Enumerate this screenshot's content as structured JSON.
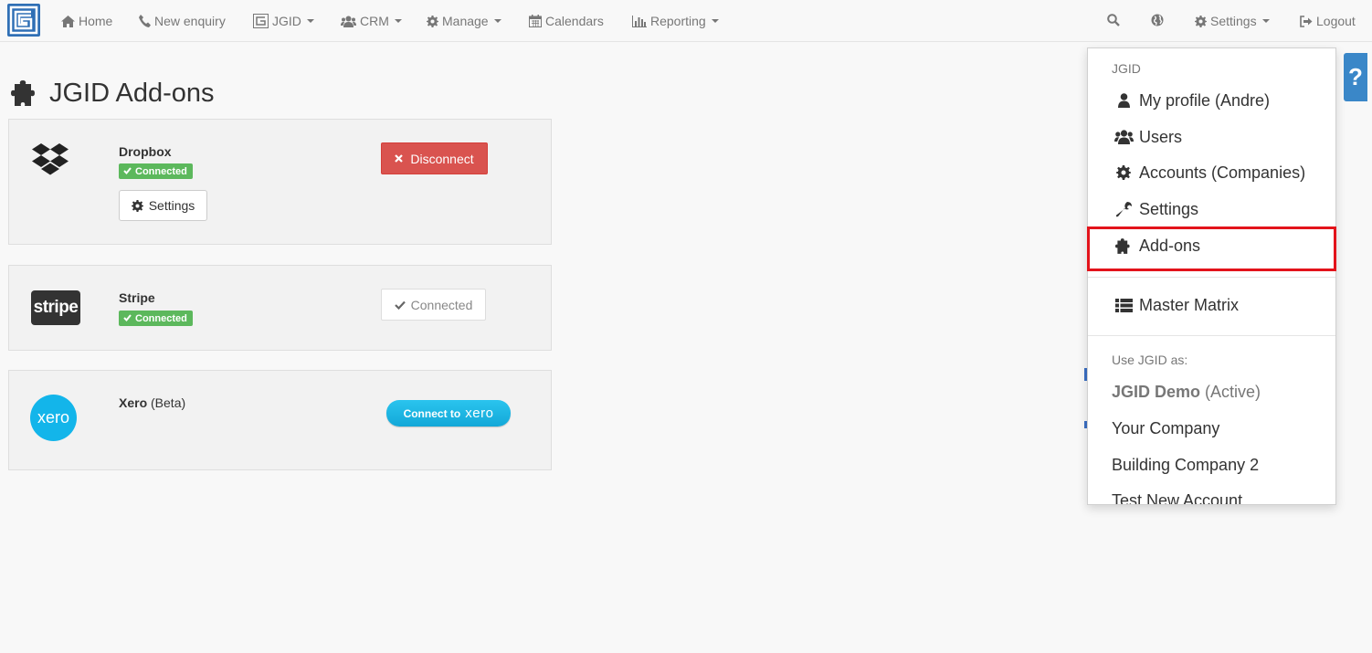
{
  "nav": {
    "home": "Home",
    "new_enquiry": "New enquiry",
    "jgid": "JGID",
    "crm": "CRM",
    "manage": "Manage",
    "calendars": "Calendars",
    "reporting": "Reporting",
    "settings": "Settings",
    "logout": "Logout"
  },
  "page": {
    "title": "JGID Add-ons"
  },
  "addons": [
    {
      "name": "Dropbox",
      "status": "Connected",
      "settings_label": "Settings",
      "action_label": "Disconnect"
    },
    {
      "name": "Stripe",
      "status": "Connected",
      "action_label": "Connected",
      "logo_text": "stripe"
    },
    {
      "name": "Xero",
      "note": "(Beta)",
      "action_label": "Connect to",
      "action_brand": "xero",
      "logo_text": "xero"
    }
  ],
  "dropdown": {
    "header": "JGID",
    "items": [
      {
        "label": "My profile (Andre)",
        "icon": "user-icon"
      },
      {
        "label": "Users",
        "icon": "users-icon"
      },
      {
        "label": "Accounts (Companies)",
        "icon": "gear-icon"
      },
      {
        "label": "Settings",
        "icon": "wrench-icon"
      },
      {
        "label": "Add-ons",
        "icon": "puzzle-icon"
      },
      {
        "label": "Master Matrix",
        "icon": "list-icon"
      }
    ],
    "use_as_header": "Use JGID as:",
    "accounts": {
      "active_name": "JGID Demo",
      "active_suffix": "(Active)",
      "others": [
        "Your Company",
        "Building Company 2",
        "Test New Account"
      ]
    }
  },
  "help": {
    "label": "?"
  },
  "colors": {
    "danger": "#d9534f",
    "success": "#5cb85c",
    "highlight": "#e3131b",
    "brand": "#2f6fb5",
    "xero": "#13b5ea"
  }
}
